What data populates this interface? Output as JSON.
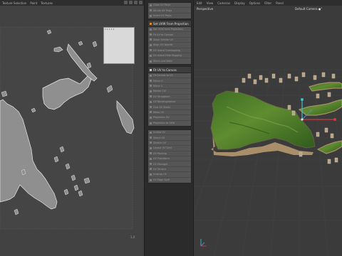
{
  "uv_editor": {
    "menu": [
      "Texture Selection",
      "Paint",
      "Textures"
    ],
    "corner_label": "1,0",
    "preview_label": "1 1 1 1 1"
  },
  "command_panel": {
    "group1": [
      {
        "label": "Grow UV Polys",
        "icon": "square-icon"
      },
      {
        "label": "Shrink UV Polys",
        "icon": "square-icon"
      },
      {
        "label": "Invert UV Polys",
        "icon": "square-icon"
      }
    ],
    "group2_header": "Set UVW From Projection",
    "group2": [
      {
        "label": "Set UVW from Projection",
        "icon": "square-icon"
      },
      {
        "label": "Fit UV to Canvas",
        "icon": "square-icon"
      },
      {
        "label": "Stack Similar UV",
        "icon": "square-icon"
      },
      {
        "label": "Align UV Islands",
        "icon": "square-icon"
      },
      {
        "label": "UV Island Overlapping",
        "icon": "square-icon"
      },
      {
        "label": "UV Island Hide Mapping",
        "icon": "square-icon"
      },
      {
        "label": "Stitch and Weld",
        "icon": "square-icon"
      }
    ],
    "group3_header": "Fit UV to Canvas",
    "group3": [
      {
        "label": "Fit Canvas to UV",
        "icon": "square-icon"
      },
      {
        "label": "Mirror U",
        "icon": "square-icon"
      },
      {
        "label": "Mirror V",
        "icon": "square-icon"
      },
      {
        "label": "Rotate CW",
        "icon": "square-icon"
      },
      {
        "label": "UV Straighten",
        "icon": "square-icon"
      },
      {
        "label": "UV Rectangularize",
        "icon": "square-icon"
      },
      {
        "label": "Grid UV Shells",
        "icon": "square-icon"
      },
      {
        "label": "Relax UV",
        "icon": "square-icon"
      },
      {
        "label": "Projection UV",
        "icon": "square-icon"
      },
      {
        "label": "Projection to UVW",
        "icon": "square-icon"
      }
    ],
    "group4": [
      {
        "label": "Unfold UV",
        "icon": "square-icon"
      },
      {
        "label": "Select UV",
        "icon": "square-icon"
      },
      {
        "label": "Stretch UV",
        "icon": "square-icon"
      },
      {
        "label": "Layout UV Grid",
        "icon": "square-icon"
      },
      {
        "label": "UV Packing",
        "icon": "square-icon"
      },
      {
        "label": "UV Transform",
        "icon": "square-icon"
      },
      {
        "label": "UV Manager",
        "icon": "square-icon"
      },
      {
        "label": "UV Terrace",
        "icon": "square-icon"
      },
      {
        "label": "Unwrap UV",
        "icon": "square-icon"
      },
      {
        "label": "UV Edge Split",
        "icon": "square-icon"
      }
    ]
  },
  "viewport": {
    "menu": [
      "Edit",
      "View",
      "Cameras",
      "Display",
      "Options",
      "Filter",
      "Panel"
    ],
    "view_name": "Perspective",
    "camera": "Default Camera ●°"
  },
  "colors": {
    "accent": "#d7872f",
    "axis_x": "#d03a3a",
    "axis_y": "#3ec0c8",
    "terrain": "#4f7a2a"
  }
}
